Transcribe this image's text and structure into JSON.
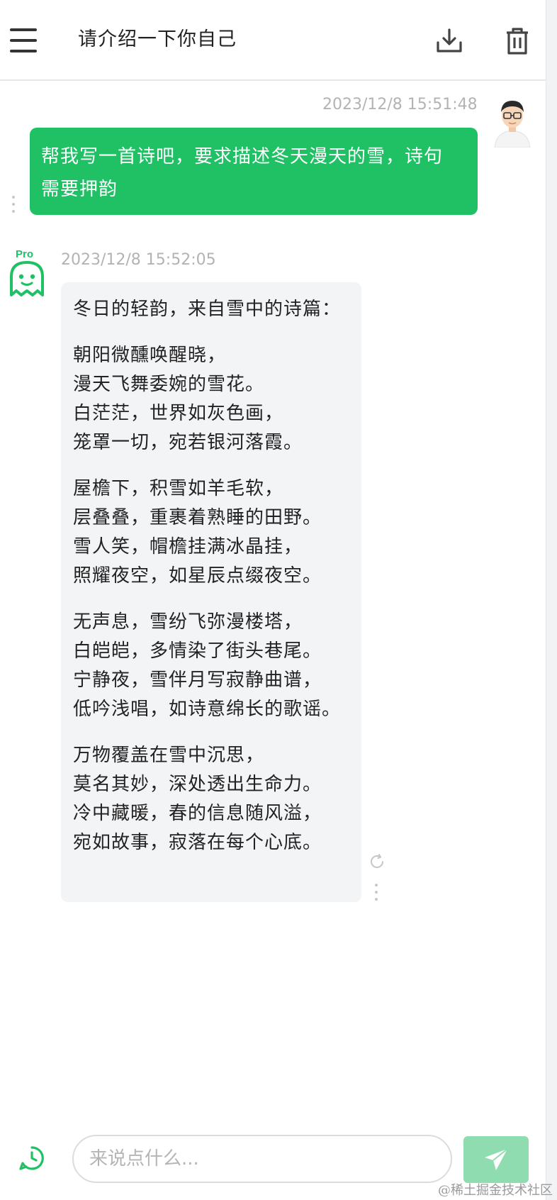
{
  "header": {
    "title": "请介绍一下你自己",
    "icons": [
      "menu-icon",
      "download-icon",
      "trash-icon"
    ]
  },
  "messages": [
    {
      "role": "user",
      "timestamp": "2023/12/8 15:51:48",
      "text_line1": "帮我写一首诗吧，要求描述冬天漫天的雪，诗句",
      "text_line2": "需要押韵"
    },
    {
      "role": "assistant",
      "badge": "Pro",
      "timestamp": "2023/12/8 15:52:05",
      "intro": "冬日的轻韵，来自雪中的诗篇：",
      "stanzas": [
        [
          "朝阳微醺唤醒晓，",
          "漫天飞舞委婉的雪花。",
          "白茫茫，世界如灰色画，",
          "笼罩一切，宛若银河落霞。"
        ],
        [
          "屋檐下，积雪如羊毛软，",
          "层叠叠，重裹着熟睡的田野。",
          "雪人笑，帽檐挂满冰晶挂，",
          "照耀夜空，如星辰点缀夜空。"
        ],
        [
          "无声息，雪纷飞弥漫楼塔，",
          "白皑皑，多情染了街头巷尾。",
          "宁静夜，雪伴月写寂静曲谱，",
          "低吟浅唱，如诗意绵长的歌谣。"
        ],
        [
          "万物覆盖在雪中沉思，",
          "莫名其妙，深处透出生命力。",
          "冷中藏暖，春的信息随风溢，",
          "宛如故事，寂落在每个心底。"
        ]
      ]
    }
  ],
  "input": {
    "placeholder": "来说点什么...",
    "value": ""
  },
  "watermark": "@稀土掘金技术社区",
  "colors": {
    "user_bubble": "#20c065",
    "bot_bubble": "#f3f4f6",
    "brand_green": "#20c065",
    "send_button": "#8fdcb1",
    "timestamp": "#b3b3b3"
  }
}
